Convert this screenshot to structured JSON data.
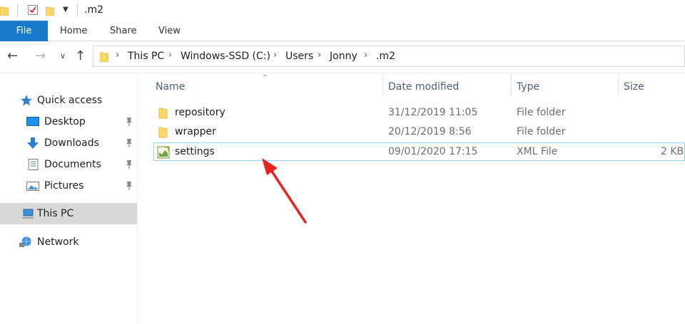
{
  "window": {
    "title": ".m2"
  },
  "ribbon": {
    "tabs": [
      "File",
      "Home",
      "Share",
      "View"
    ]
  },
  "address": {
    "breadcrumbs": [
      "This PC",
      "Windows-SSD (C:)",
      "Users",
      "Jonny",
      ".m2"
    ]
  },
  "sidebar": {
    "quick_access": "Quick access",
    "items": [
      {
        "label": "Desktop",
        "icon": "desktop-icon"
      },
      {
        "label": "Downloads",
        "icon": "download-arrow-icon"
      },
      {
        "label": "Documents",
        "icon": "document-icon"
      },
      {
        "label": "Pictures",
        "icon": "pictures-icon"
      }
    ],
    "this_pc": "This PC",
    "network": "Network"
  },
  "columns": {
    "name": "Name",
    "date": "Date modified",
    "type": "Type",
    "size": "Size"
  },
  "files": [
    {
      "name": "repository",
      "date": "31/12/2019 11:05",
      "type": "File folder",
      "size": "",
      "icon": "folder-icon"
    },
    {
      "name": "wrapper",
      "date": "20/12/2019 8:56",
      "type": "File folder",
      "size": "",
      "icon": "folder-icon"
    },
    {
      "name": "settings",
      "date": "09/01/2020 17:15",
      "type": "XML File",
      "size": "2 KB",
      "icon": "xml-file-icon"
    }
  ],
  "colors": {
    "accent": "#1979ca",
    "annotation_arrow": "#e8231f",
    "selection_border": "#99d1ff"
  }
}
